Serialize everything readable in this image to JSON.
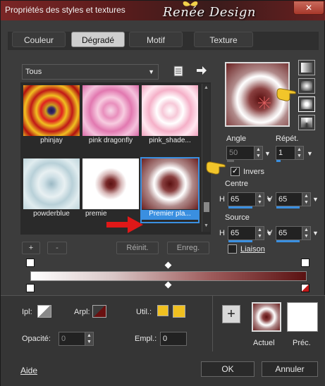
{
  "window": {
    "title": "Propriétés des styles et textures",
    "brand": "Renée Design",
    "close_glyph": "✕"
  },
  "tabs": [
    {
      "label": "Couleur",
      "active": false
    },
    {
      "label": "Dégradé",
      "active": true
    },
    {
      "label": "Motif",
      "active": false
    },
    {
      "label": "Texture",
      "active": false
    }
  ],
  "library": {
    "category_value": "Tous",
    "thumbnails": [
      {
        "name": "phinjay",
        "selected": false
      },
      {
        "name": "pink dragonfly",
        "selected": false
      },
      {
        "name": "pink_shade...",
        "selected": false
      },
      {
        "name": "powderblue",
        "selected": false
      },
      {
        "name": "premie",
        "selected": false
      },
      {
        "name": "Premier pla...",
        "selected": true
      }
    ],
    "add_label": "+",
    "remove_label": "-",
    "reset_label": "Réinit.",
    "save_label": "Enreg."
  },
  "settings": {
    "angle_label": "Angle",
    "angle_value": "50",
    "repeat_label": "Répét.",
    "repeat_value": "1",
    "invert_label": "Invers",
    "invert_checked": true,
    "center_label": "Centre",
    "center_h": "65",
    "center_v": "65",
    "source_label": "Source",
    "source_h": "65",
    "source_v": "65",
    "link_label": "Liaison",
    "link_checked": false,
    "h_label": "H",
    "v_label": "V"
  },
  "bottom": {
    "ipl_label": "Ipl:",
    "arpl_label": "Arpl:",
    "util_label": "Util.:",
    "opacity_label": "Opacité:",
    "opacity_value": "0",
    "empl_label": "Empl.:",
    "empl_value": "0",
    "add_glyph": "+",
    "current_label": "Actuel",
    "previous_label": "Préc.",
    "help_label": "Aide",
    "ok_label": "OK",
    "cancel_label": "Annuler"
  },
  "colors": {
    "accent": "#3a8fe0",
    "dark_red": "#5a1212",
    "yellow": "#f0c020"
  },
  "icons": [
    "close-icon",
    "new-gradient-icon",
    "export-arrow-icon",
    "butterfly-icon",
    "pointing-hand-icon",
    "red-arrow-icon",
    "center-cross-icon"
  ]
}
